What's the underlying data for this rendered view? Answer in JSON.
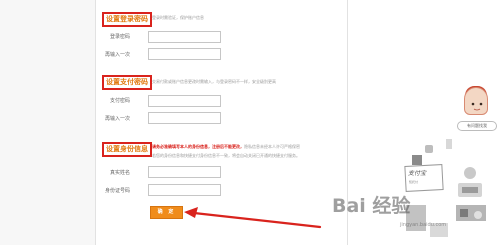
{
  "sections": [
    {
      "title": "设置登录密码",
      "desc": "登录时需验证，保护账户信息",
      "fields": [
        {
          "label": "登录密码"
        },
        {
          "label": "再输入一次"
        }
      ]
    },
    {
      "title": "设置支付密码",
      "desc": "交易付款或账户信息更改时需输入，与登录密码不一样，安全级别更高",
      "fields": [
        {
          "label": "支付密码"
        },
        {
          "label": "再输入一次"
        }
      ]
    },
    {
      "title": "设置身份信息",
      "desc_warn": "请务必准确填写本人的身份信息，注册后不能更改，",
      "desc_rest": "隐私信息未经本人许可严格保密",
      "desc_line2": "若您的身份信息和快捷支付身份信息不一致，将会自动关闭已开通的快捷支付服务。",
      "fields": [
        {
          "label": "真实姓名"
        },
        {
          "label": "身份证号码"
        }
      ]
    }
  ],
  "submit_label": "确 定",
  "right_panel": {
    "help_label": "有问题找我",
    "alipay_logo": "支付宝",
    "alipay_sub": "知托付"
  },
  "watermark": {
    "text": "Bai 经验",
    "sub": "jingyan.baidu.com"
  },
  "colors": {
    "highlight_box": "#d9231d",
    "title_text": "#e07a10",
    "button": "#f08c1b",
    "arrow": "#d9231d"
  }
}
